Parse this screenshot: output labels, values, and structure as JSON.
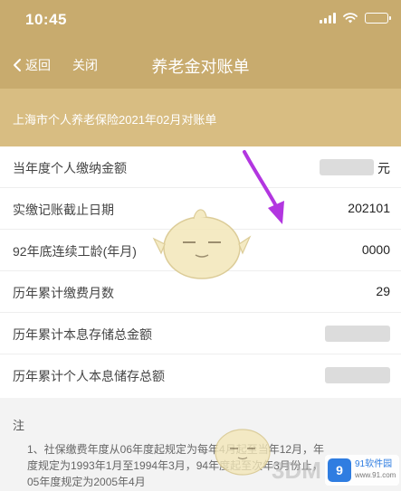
{
  "status_bar": {
    "time": "10:45"
  },
  "nav": {
    "back_label": "返回",
    "close_label": "关闭",
    "title": "养老金对账单"
  },
  "subheader": {
    "text": "上海市个人养老保险2021年02月对账单"
  },
  "rows": [
    {
      "label": "当年度个人缴纳金额",
      "value": "元",
      "masked": true
    },
    {
      "label": "实缴记账截止日期",
      "value": "202101",
      "masked": false
    },
    {
      "label": "92年底连续工龄(年月)",
      "value": "0000",
      "masked": false
    },
    {
      "label": "历年累计缴费月数",
      "value": "29",
      "masked": false
    },
    {
      "label": "历年累计本息存储总金额",
      "value": "",
      "masked": true
    },
    {
      "label": "历年累计个人本息储存总额",
      "value": "",
      "masked": true
    }
  ],
  "notes": {
    "title": "注",
    "body": "1、社保缴费年度从06年度起规定为每年4月起至当年12月，年度规定为1993年1月至1994年3月，94年度起至次年3月份止，05年度规定为2005年4月"
  },
  "watermarks": {
    "game_site": "3DM",
    "badge_logo": "9",
    "badge_name": "91软件园",
    "badge_sub": "www.91.com"
  },
  "colors": {
    "header": "#c8ab6e",
    "subheader": "#d8bd82",
    "arrow": "#b236e0",
    "background": "#f3f3f3"
  }
}
